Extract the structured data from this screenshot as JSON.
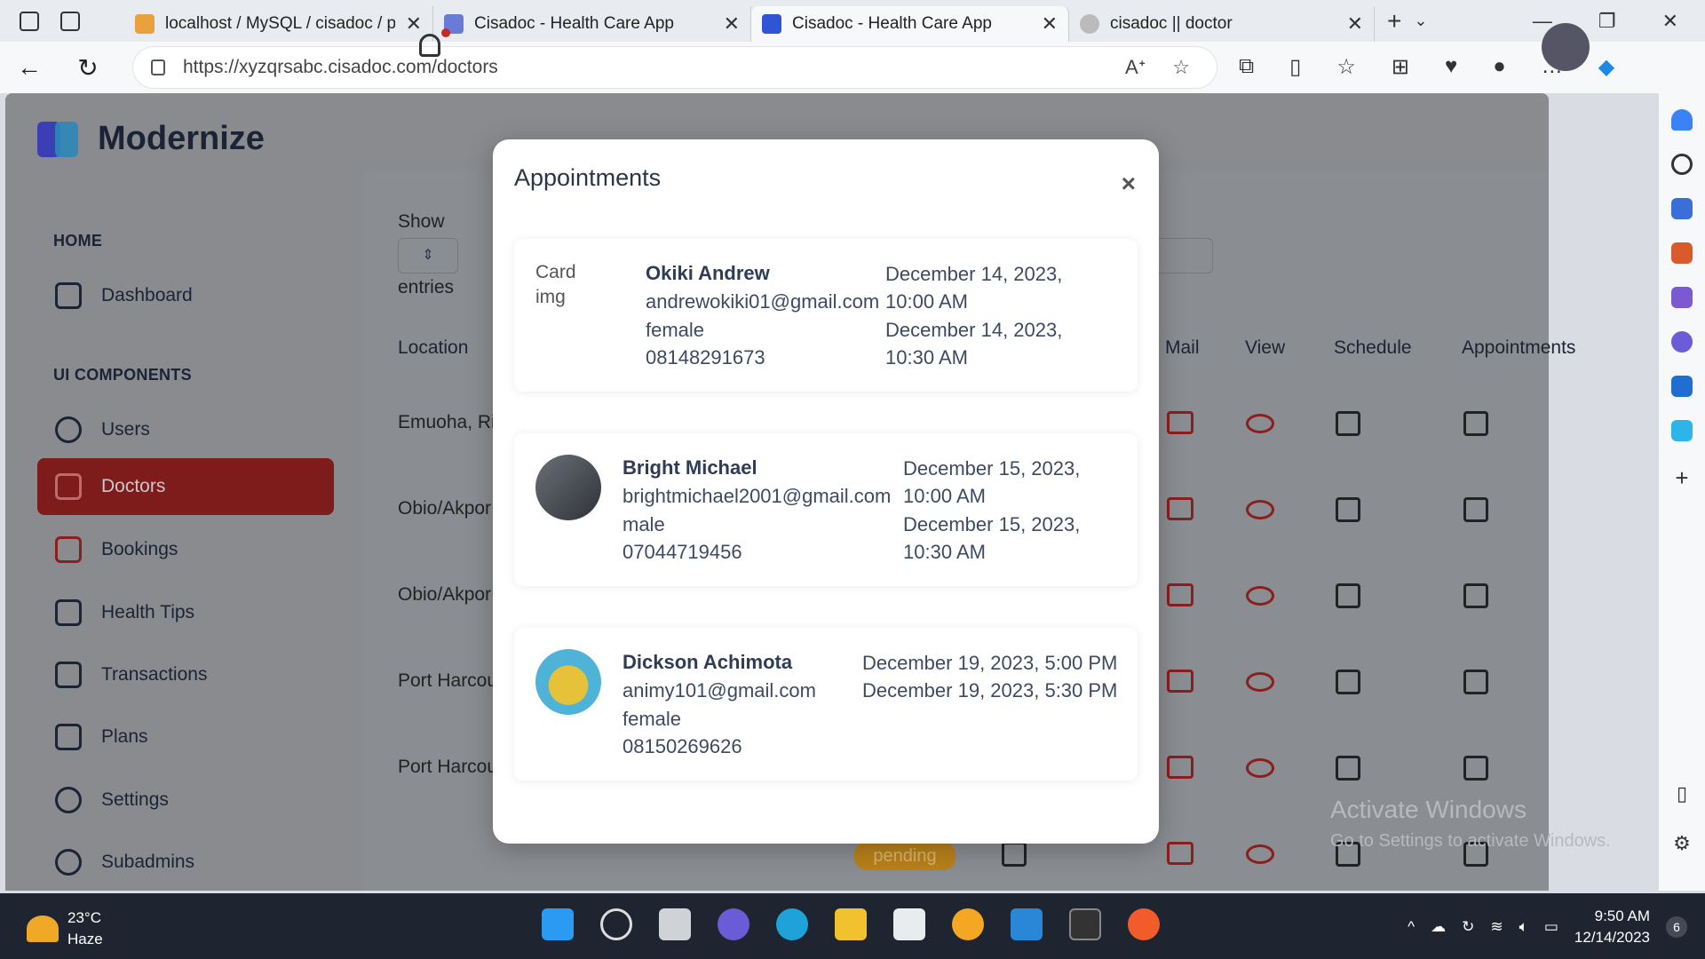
{
  "browser": {
    "tabs": [
      {
        "title": "localhost / MySQL / cisadoc / pat",
        "active": false
      },
      {
        "title": "Cisadoc - Health Care App",
        "active": false
      },
      {
        "title": "Cisadoc - Health Care App",
        "active": true
      },
      {
        "title": "cisadoc || doctor",
        "active": false
      }
    ],
    "url": "https://xyzqrsabc.cisadoc.com/doctors"
  },
  "app": {
    "logo_text": "Modernize",
    "nav_home_caption": "HOME",
    "nav_ui_caption": "UI COMPONENTS",
    "nav": [
      {
        "label": "Dashboard",
        "icon": "dashboard-icon"
      },
      {
        "label": "Users",
        "icon": "users-icon"
      },
      {
        "label": "Doctors",
        "icon": "medical-cross-icon",
        "active": true
      },
      {
        "label": "Bookings",
        "icon": "calendar-clock-icon"
      },
      {
        "label": "Health Tips",
        "icon": "news-icon"
      },
      {
        "label": "Transactions",
        "icon": "wallet-icon"
      },
      {
        "label": "Plans",
        "icon": "bag-icon"
      },
      {
        "label": "Settings",
        "icon": "gear-icon"
      },
      {
        "label": "Subadmins",
        "icon": "gear-icon"
      }
    ],
    "accent_color": "#7e1b1b"
  },
  "table": {
    "show_label": "Show",
    "entries_label": "entries",
    "headers": {
      "location": "Location",
      "mail": "Mail",
      "view": "View",
      "schedule": "Schedule",
      "appointments": "Appointments"
    },
    "locations": [
      "Emuoha, Riv",
      "Obio/Akpor",
      "Obio/Akpor",
      "Port Harcou",
      "Port Harcou"
    ],
    "status_badge": "pending"
  },
  "modal": {
    "title": "Appointments",
    "close_label": "×",
    "appointments": [
      {
        "image_alt": "Card img",
        "name": "Okiki Andrew",
        "email": "andrewokiki01@gmail.com",
        "gender": "female",
        "phone": "08148291673",
        "start": "December 14, 2023,\n10:00 AM",
        "end": "December 14, 2023,\n10:30 AM"
      },
      {
        "name": "Bright Michael",
        "email": "brightmichael2001@gmail.com",
        "gender": "male",
        "phone": "07044719456",
        "start": "December 15, 2023,\n10:00 AM",
        "end": "December 15, 2023,\n10:30 AM"
      },
      {
        "name": "Dickson Achimota",
        "email": "animy101@gmail.com",
        "gender": "female",
        "phone": "08150269626",
        "start": "December 19, 2023, 5:00 PM",
        "end": "December 19, 2023, 5:30 PM"
      }
    ]
  },
  "watermark": {
    "line1": "Activate Windows",
    "line2": "Go to Settings to activate Windows."
  },
  "taskbar": {
    "temp": "23°C",
    "condition": "Haze",
    "time": "9:50 AM",
    "date": "12/14/2023",
    "notifications": "6"
  }
}
